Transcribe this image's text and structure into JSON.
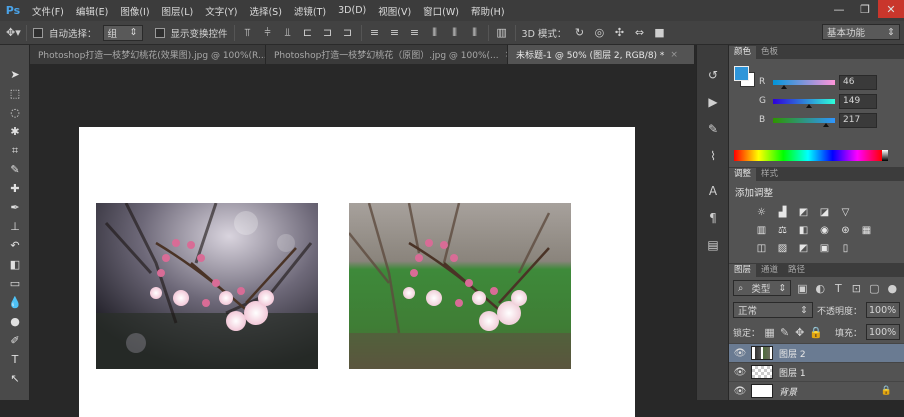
{
  "app": {
    "logo": "Ps"
  },
  "menu": [
    "文件(F)",
    "编辑(E)",
    "图像(I)",
    "图层(L)",
    "文字(Y)",
    "选择(S)",
    "滤镜(T)",
    "3D(D)",
    "视图(V)",
    "窗口(W)",
    "帮助(H)"
  ],
  "window_controls": {
    "minimize": "—",
    "restore": "❐",
    "close": "✕"
  },
  "options": {
    "auto_select_label": "自动选择：",
    "auto_select_value": "组",
    "show_transform_label": "显示变换控件",
    "mode_3d_label": "3D 模式：",
    "workspace": "基本功能"
  },
  "tabs": [
    {
      "label": "Photoshop打造一枝梦幻桃花(效果图).jpg @ 100%(R...",
      "close": "×",
      "active": false
    },
    {
      "label": "Photoshop打造一枝梦幻桃花（原图）.jpg @ 100%(...",
      "close": "×",
      "active": false
    },
    {
      "label": "未标题-1 @ 50% (图层 2, RGB/8) *",
      "close": "×",
      "active": true
    }
  ],
  "color_panel": {
    "tabs": [
      "颜色",
      "色板"
    ],
    "r_label": "R",
    "g_label": "G",
    "b_label": "B",
    "r": "46",
    "g": "149",
    "b": "217",
    "r_fraction": 0.18,
    "g_fraction": 0.58,
    "b_fraction": 0.85,
    "fg_color": "#2e95d9"
  },
  "adjust_panel": {
    "tabs": [
      "调整",
      "样式"
    ],
    "title": "添加调整"
  },
  "layers_panel": {
    "tabs": [
      "图层",
      "通道",
      "路径"
    ],
    "kind_label": "类型",
    "blend_mode": "正常",
    "opacity_label": "不透明度：",
    "opacity_value": "100%",
    "lock_label": "锁定：",
    "fill_label": "填充：",
    "fill_value": "100%",
    "layers": [
      {
        "name": "图层 2",
        "selected": true
      },
      {
        "name": "图层 1",
        "selected": false
      },
      {
        "name": "背景",
        "selected": false,
        "locked": true
      }
    ]
  },
  "colors": {
    "accent": "#2e95d9",
    "selected_layer": "#6a7b92",
    "close_button": "#c9362c"
  }
}
